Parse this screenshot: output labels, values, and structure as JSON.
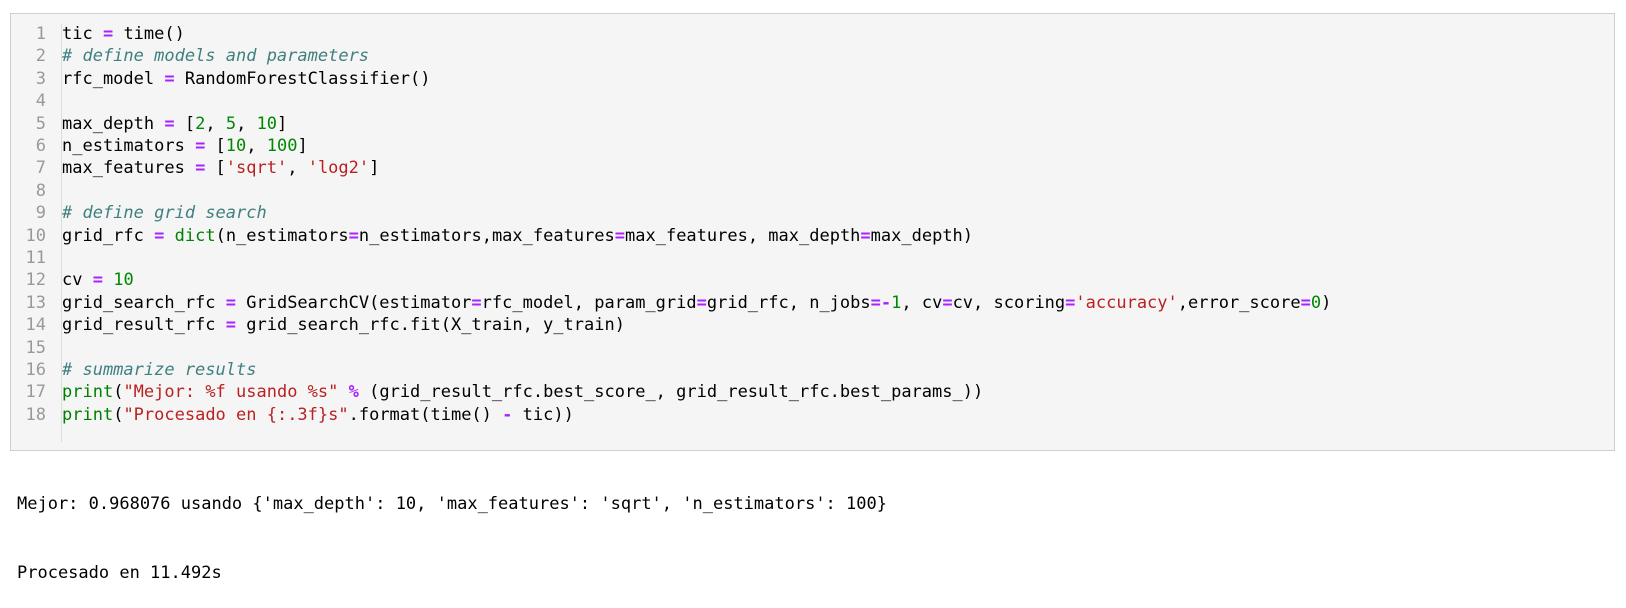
{
  "code_cell": {
    "lines": [
      {
        "num": "1",
        "segments": [
          {
            "t": "tic ",
            "c": ""
          },
          {
            "t": "=",
            "c": "op"
          },
          {
            "t": " time()",
            "c": ""
          }
        ]
      },
      {
        "num": "2",
        "segments": [
          {
            "t": "# define models and parameters",
            "c": "comment"
          }
        ]
      },
      {
        "num": "3",
        "segments": [
          {
            "t": "rfc_model ",
            "c": ""
          },
          {
            "t": "=",
            "c": "op"
          },
          {
            "t": " RandomForestClassifier()",
            "c": ""
          }
        ]
      },
      {
        "num": "4",
        "segments": []
      },
      {
        "num": "5",
        "segments": [
          {
            "t": "max_depth ",
            "c": ""
          },
          {
            "t": "=",
            "c": "op"
          },
          {
            "t": " [",
            "c": ""
          },
          {
            "t": "2",
            "c": "num"
          },
          {
            "t": ", ",
            "c": ""
          },
          {
            "t": "5",
            "c": "num"
          },
          {
            "t": ", ",
            "c": ""
          },
          {
            "t": "10",
            "c": "num"
          },
          {
            "t": "]",
            "c": ""
          }
        ]
      },
      {
        "num": "6",
        "segments": [
          {
            "t": "n_estimators ",
            "c": ""
          },
          {
            "t": "=",
            "c": "op"
          },
          {
            "t": " [",
            "c": ""
          },
          {
            "t": "10",
            "c": "num"
          },
          {
            "t": ", ",
            "c": ""
          },
          {
            "t": "100",
            "c": "num"
          },
          {
            "t": "]",
            "c": ""
          }
        ]
      },
      {
        "num": "7",
        "segments": [
          {
            "t": "max_features ",
            "c": ""
          },
          {
            "t": "=",
            "c": "op"
          },
          {
            "t": " [",
            "c": ""
          },
          {
            "t": "'sqrt'",
            "c": "str"
          },
          {
            "t": ", ",
            "c": ""
          },
          {
            "t": "'log2'",
            "c": "str"
          },
          {
            "t": "]",
            "c": ""
          }
        ]
      },
      {
        "num": "8",
        "segments": []
      },
      {
        "num": "9",
        "segments": [
          {
            "t": "# define grid search",
            "c": "comment"
          }
        ]
      },
      {
        "num": "10",
        "segments": [
          {
            "t": "grid_rfc ",
            "c": ""
          },
          {
            "t": "=",
            "c": "op"
          },
          {
            "t": " ",
            "c": ""
          },
          {
            "t": "dict",
            "c": "builtin"
          },
          {
            "t": "(n_estimators",
            "c": ""
          },
          {
            "t": "=",
            "c": "op"
          },
          {
            "t": "n_estimators,max_features",
            "c": ""
          },
          {
            "t": "=",
            "c": "op"
          },
          {
            "t": "max_features, max_depth",
            "c": ""
          },
          {
            "t": "=",
            "c": "op"
          },
          {
            "t": "max_depth)",
            "c": ""
          }
        ]
      },
      {
        "num": "11",
        "segments": []
      },
      {
        "num": "12",
        "segments": [
          {
            "t": "cv ",
            "c": ""
          },
          {
            "t": "=",
            "c": "op"
          },
          {
            "t": " ",
            "c": ""
          },
          {
            "t": "10",
            "c": "num"
          }
        ]
      },
      {
        "num": "13",
        "segments": [
          {
            "t": "grid_search_rfc ",
            "c": ""
          },
          {
            "t": "=",
            "c": "op"
          },
          {
            "t": " GridSearchCV(estimator",
            "c": ""
          },
          {
            "t": "=",
            "c": "op"
          },
          {
            "t": "rfc_model, param_grid",
            "c": ""
          },
          {
            "t": "=",
            "c": "op"
          },
          {
            "t": "grid_rfc, n_jobs",
            "c": ""
          },
          {
            "t": "=-",
            "c": "op"
          },
          {
            "t": "1",
            "c": "num"
          },
          {
            "t": ", cv",
            "c": ""
          },
          {
            "t": "=",
            "c": "op"
          },
          {
            "t": "cv, scoring",
            "c": ""
          },
          {
            "t": "=",
            "c": "op"
          },
          {
            "t": "'accuracy'",
            "c": "str"
          },
          {
            "t": ",error_score",
            "c": ""
          },
          {
            "t": "=",
            "c": "op"
          },
          {
            "t": "0",
            "c": "num"
          },
          {
            "t": ")",
            "c": ""
          }
        ]
      },
      {
        "num": "14",
        "segments": [
          {
            "t": "grid_result_rfc ",
            "c": ""
          },
          {
            "t": "=",
            "c": "op"
          },
          {
            "t": " grid_search_rfc.fit(X_train, y_train)",
            "c": ""
          }
        ]
      },
      {
        "num": "15",
        "segments": []
      },
      {
        "num": "16",
        "segments": [
          {
            "t": "# summarize results",
            "c": "comment"
          }
        ]
      },
      {
        "num": "17",
        "segments": [
          {
            "t": "print",
            "c": "builtin"
          },
          {
            "t": "(",
            "c": ""
          },
          {
            "t": "\"Mejor: %f usando %s\"",
            "c": "str"
          },
          {
            "t": " ",
            "c": ""
          },
          {
            "t": "%",
            "c": "op"
          },
          {
            "t": " (grid_result_rfc.best_score_, grid_result_rfc.best_params_))",
            "c": ""
          }
        ]
      },
      {
        "num": "18",
        "segments": [
          {
            "t": "print",
            "c": "builtin"
          },
          {
            "t": "(",
            "c": ""
          },
          {
            "t": "\"Procesado en {:.3f}s\"",
            "c": "str"
          },
          {
            "t": ".format(time() ",
            "c": ""
          },
          {
            "t": "-",
            "c": "op"
          },
          {
            "t": " tic))",
            "c": ""
          }
        ]
      }
    ]
  },
  "output": {
    "line1": "Mejor: 0.968076 usando {'max_depth': 10, 'max_features': 'sqrt', 'n_estimators': 100}",
    "line2": "Procesado en 11.492s"
  },
  "colors": {
    "cell_background": "#f5f5f5",
    "cell_border": "#cfcfcf",
    "operator": "#aa22ff",
    "comment": "#408080",
    "number": "#008800",
    "string": "#ba2121",
    "builtin": "#008000",
    "line_number": "#999999"
  }
}
